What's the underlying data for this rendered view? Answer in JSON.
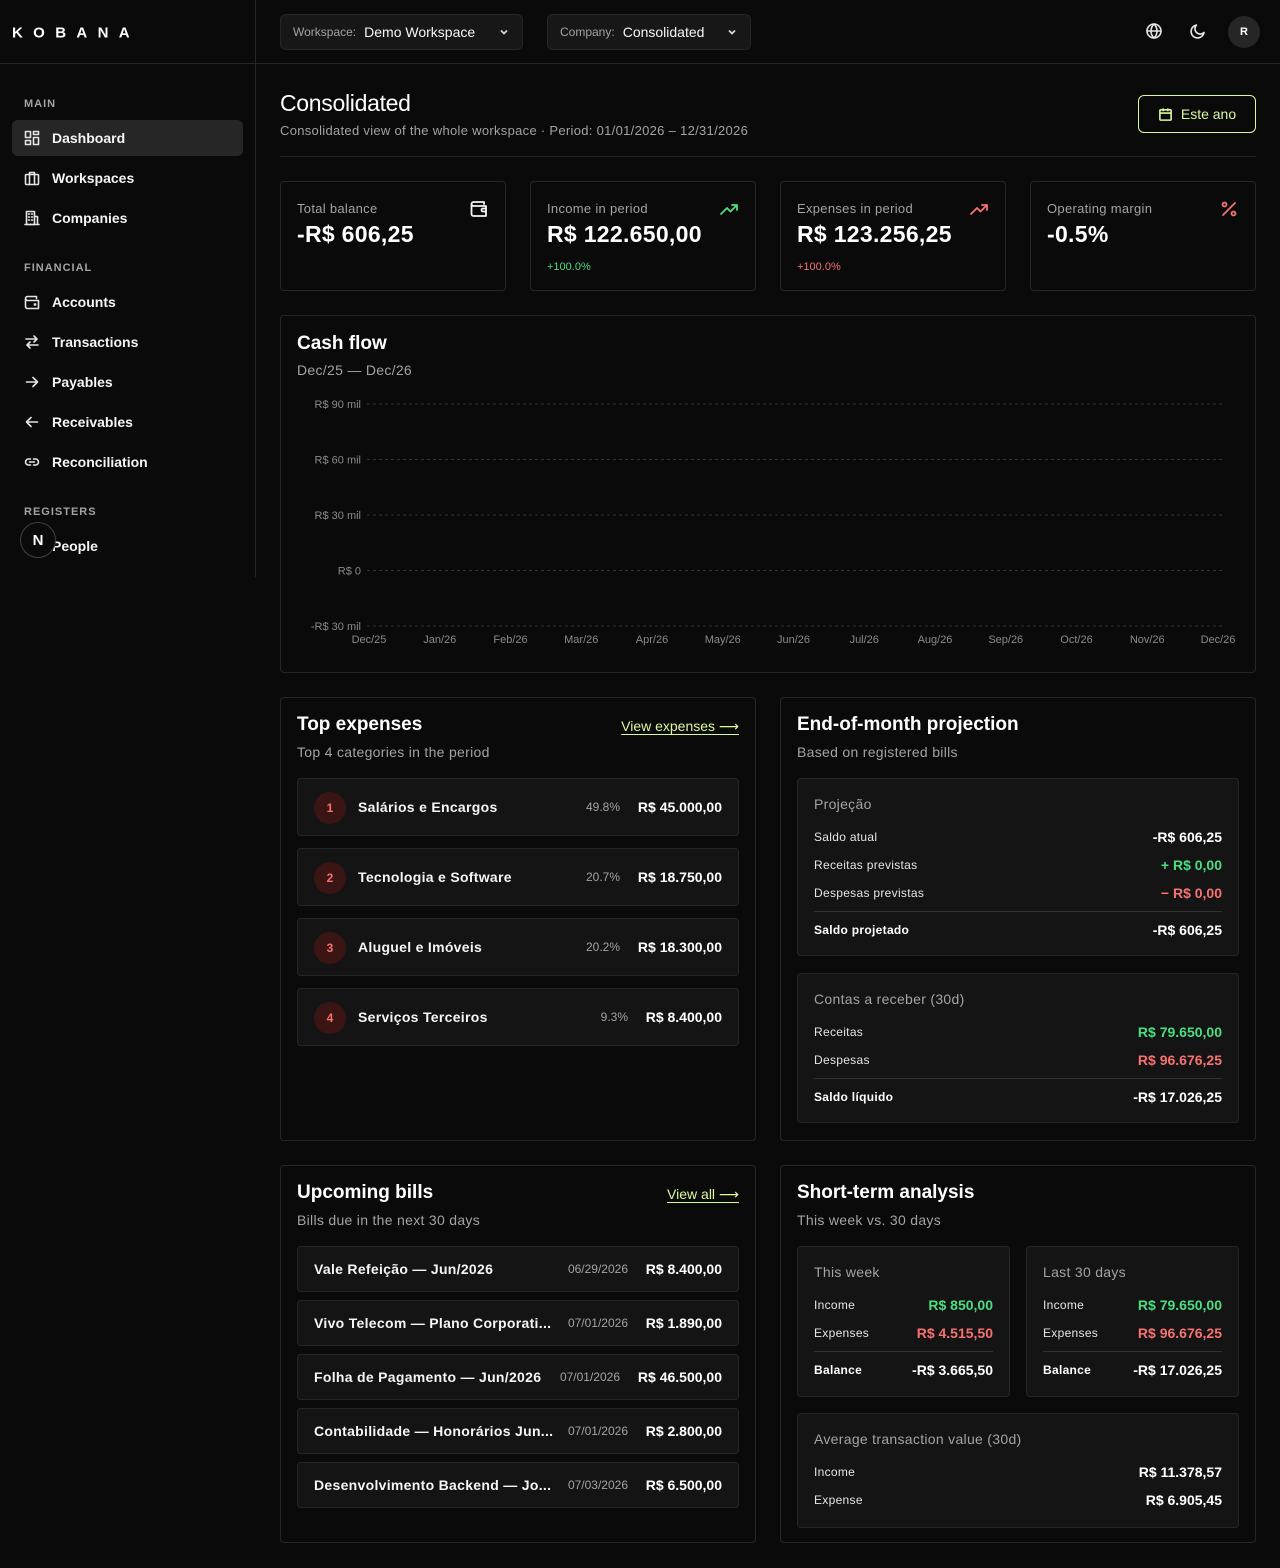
{
  "brand": {
    "logo_text": "KOBANA"
  },
  "topbar": {
    "workspace_label": "Workspace:",
    "workspace_value": "Demo Workspace",
    "company_label": "Company:",
    "company_value": "Consolidated",
    "avatar_initial": "R"
  },
  "sidebar": {
    "sections": [
      {
        "title": "MAIN",
        "items": [
          {
            "label": "Dashboard",
            "icon": "dashboard-icon",
            "active": true
          },
          {
            "label": "Workspaces",
            "icon": "briefcase-icon"
          },
          {
            "label": "Companies",
            "icon": "building-icon"
          }
        ]
      },
      {
        "title": "FINANCIAL",
        "items": [
          {
            "label": "Accounts",
            "icon": "wallet-icon"
          },
          {
            "label": "Transactions",
            "icon": "arrows-swap-icon"
          },
          {
            "label": "Payables",
            "icon": "arrow-right-icon"
          },
          {
            "label": "Receivables",
            "icon": "arrow-left-icon"
          },
          {
            "label": "Reconciliation",
            "icon": "link-icon"
          }
        ]
      },
      {
        "title": "REGISTERS",
        "items": [
          {
            "label": "People",
            "icon": "users-icon"
          }
        ]
      }
    ],
    "badge": "N"
  },
  "header": {
    "title": "Consolidated",
    "subtitle": "Consolidated view of the whole workspace · Period: 01/01/2026 – 12/31/2026",
    "period_button": "Este ano"
  },
  "kpis": [
    {
      "label": "Total balance",
      "value": "-R$ 606,25",
      "delta": "",
      "icon": "wallet-icon"
    },
    {
      "label": "Income in period",
      "value": "R$ 122.650,00",
      "delta": "+100.0%",
      "icon": "trend-up-icon"
    },
    {
      "label": "Expenses in period",
      "value": "R$ 123.256,25",
      "delta": "+100.0%",
      "icon": "trend-up-icon"
    },
    {
      "label": "Operating margin",
      "value": "-0.5%",
      "delta": "",
      "icon": "percent-icon"
    }
  ],
  "colors": {
    "accent": "#d9f99d",
    "positive": "#4ade80",
    "negative": "#f87171"
  },
  "cashflow": {
    "title": "Cash flow",
    "subtitle": "Dec/25 — Dec/26"
  },
  "chart_data": {
    "type": "line",
    "title": "Cash flow",
    "x": [
      "Dec/25",
      "Jan/26",
      "Feb/26",
      "Mar/26",
      "Apr/26",
      "May/26",
      "Jun/26",
      "Jul/26",
      "Aug/26",
      "Sep/26",
      "Oct/26",
      "Nov/26",
      "Dec/26"
    ],
    "y_ticks": [
      "R$ 90 mil",
      "R$ 60 mil",
      "R$ 30 mil",
      "R$ 0",
      "-R$ 30 mil"
    ],
    "ylim": [
      -30000,
      90000
    ],
    "grid": true,
    "series": []
  },
  "top_expenses": {
    "title": "Top expenses",
    "subtitle": "Top 4 categories in the period",
    "link": "View expenses ⟶",
    "items": [
      {
        "rank": "1",
        "name": "Salários e Encargos",
        "pct": "49.8%",
        "amount": "R$ 45.000,00"
      },
      {
        "rank": "2",
        "name": "Tecnologia e Software",
        "pct": "20.7%",
        "amount": "R$ 18.750,00"
      },
      {
        "rank": "3",
        "name": "Aluguel e Imóveis",
        "pct": "20.2%",
        "amount": "R$ 18.300,00"
      },
      {
        "rank": "4",
        "name": "Serviços Terceiros",
        "pct": "9.3%",
        "amount": "R$ 8.400,00"
      }
    ]
  },
  "projection": {
    "title": "End-of-month projection",
    "subtitle": "Based on registered bills",
    "box1": {
      "title": "Projeção",
      "rows": [
        {
          "label": "Saldo atual",
          "value": "-R$ 606,25"
        },
        {
          "label": "Receitas previstas",
          "value": "+ R$ 0,00"
        },
        {
          "label": "Despesas previstas",
          "value": "− R$ 0,00"
        }
      ],
      "total_label": "Saldo projetado",
      "total_value": "-R$ 606,25"
    },
    "box2": {
      "title": "Contas a receber (30d)",
      "rows": [
        {
          "label": "Receitas",
          "value": "R$ 79.650,00"
        },
        {
          "label": "Despesas",
          "value": "R$ 96.676,25"
        }
      ],
      "total_label": "Saldo líquido",
      "total_value": "-R$ 17.026,25"
    }
  },
  "upcoming": {
    "title": "Upcoming bills",
    "subtitle": "Bills due in the next 30 days",
    "link": "View all ⟶",
    "items": [
      {
        "name": "Vale Refeição — Jun/2026",
        "date": "06/29/2026",
        "amount": "R$ 8.400,00"
      },
      {
        "name": "Vivo Telecom — Plano Corporati...",
        "date": "07/01/2026",
        "amount": "R$ 1.890,00"
      },
      {
        "name": "Folha de Pagamento — Jun/2026",
        "date": "07/01/2026",
        "amount": "R$ 46.500,00"
      },
      {
        "name": "Contabilidade — Honorários Jun...",
        "date": "07/01/2026",
        "amount": "R$ 2.800,00"
      },
      {
        "name": "Desenvolvimento Backend — Jo...",
        "date": "07/03/2026",
        "amount": "R$ 6.500,00"
      }
    ]
  },
  "short_term": {
    "title": "Short-term analysis",
    "subtitle": "This week vs. 30 days",
    "week": {
      "title": "This week",
      "income_label": "Income",
      "income": "R$ 850,00",
      "expenses_label": "Expenses",
      "expenses": "R$ 4.515,50",
      "balance_label": "Balance",
      "balance": "-R$ 3.665,50"
    },
    "month": {
      "title": "Last 30 days",
      "income_label": "Income",
      "income": "R$ 79.650,00",
      "expenses_label": "Expenses",
      "expenses": "R$ 96.676,25",
      "balance_label": "Balance",
      "balance": "-R$ 17.026,25"
    },
    "avg": {
      "title": "Average transaction value (30d)",
      "income_label": "Income",
      "income": "R$ 11.378,57",
      "expense_label": "Expense",
      "expense": "R$ 6.905,45"
    }
  }
}
